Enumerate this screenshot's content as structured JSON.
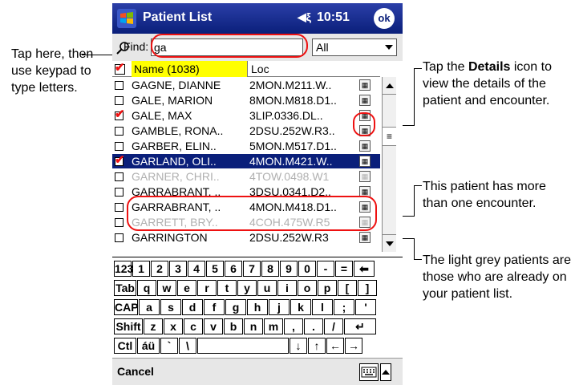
{
  "titlebar": {
    "title": "Patient List",
    "time": "10:51",
    "ok_label": "ok",
    "speaker": "◀ξ"
  },
  "find": {
    "label": "Find:",
    "value": "ga",
    "filter_value": "All"
  },
  "list": {
    "header_name": "Name (1038)",
    "header_loc": "Loc",
    "rows": [
      {
        "name": "GAGNE, DIANNE",
        "loc": "2MON.M211.W..",
        "checked": false,
        "state": "normal"
      },
      {
        "name": "GALE, MARION",
        "loc": "8MON.M818.D1..",
        "checked": false,
        "state": "normal"
      },
      {
        "name": "GALE, MAX",
        "loc": "3LIP.0336.DL..",
        "checked": true,
        "state": "normal"
      },
      {
        "name": "GAMBLE, RONA..",
        "loc": "2DSU.252W.R3..",
        "checked": false,
        "state": "normal"
      },
      {
        "name": "GARBER, ELIN..",
        "loc": "5MON.M517.D1..",
        "checked": false,
        "state": "normal"
      },
      {
        "name": "GARLAND, OLI..",
        "loc": "4MON.M421.W..",
        "checked": true,
        "state": "selected"
      },
      {
        "name": "GARNER, CHRI..",
        "loc": "4TOW.0498.W1",
        "checked": false,
        "state": "grey"
      },
      {
        "name": "GARRABRANT, ..",
        "loc": "3DSU.0341.D2..",
        "checked": false,
        "state": "normal"
      },
      {
        "name": "GARRABRANT, ..",
        "loc": "4MON.M418.D1..",
        "checked": false,
        "state": "normal"
      },
      {
        "name": "GARRETT, BRY..",
        "loc": "4COH.475W.R5",
        "checked": false,
        "state": "grey"
      },
      {
        "name": "GARRINGTON",
        "loc": "2DSU.252W.R3",
        "checked": false,
        "state": "normal"
      }
    ]
  },
  "keyboard": {
    "rows": [
      [
        "123",
        "1",
        "2",
        "3",
        "4",
        "5",
        "6",
        "7",
        "8",
        "9",
        "0",
        "-",
        "=",
        "⬅"
      ],
      [
        "Tab",
        "q",
        "w",
        "e",
        "r",
        "t",
        "y",
        "u",
        "i",
        "o",
        "p",
        "[",
        "]"
      ],
      [
        "CAP",
        "a",
        "s",
        "d",
        "f",
        "g",
        "h",
        "j",
        "k",
        "l",
        ";",
        "'"
      ],
      [
        "Shift",
        "z",
        "x",
        "c",
        "v",
        "b",
        "n",
        "m",
        ",",
        ".",
        "/",
        "↵"
      ],
      [
        "Ctl",
        "áü",
        "`",
        "\\",
        "",
        "↓",
        "↑",
        "←",
        "→"
      ]
    ]
  },
  "cmdbar": {
    "cancel_label": "Cancel"
  },
  "callouts": {
    "left": "Tap here, then use keypad to type letters.",
    "details_prefix": "Tap the ",
    "details_bold": "Details",
    "details_suffix": " icon to view the details of the patient and encounter.",
    "multi_encounter": "This patient has more than one encounter.",
    "grey_patients": "The light grey patients are those who are already on your patient list."
  },
  "colors": {
    "titlebar": "#0a1f7a",
    "highlight_header": "#ffff00",
    "annotation": "#e11111",
    "check": "#e11111"
  }
}
